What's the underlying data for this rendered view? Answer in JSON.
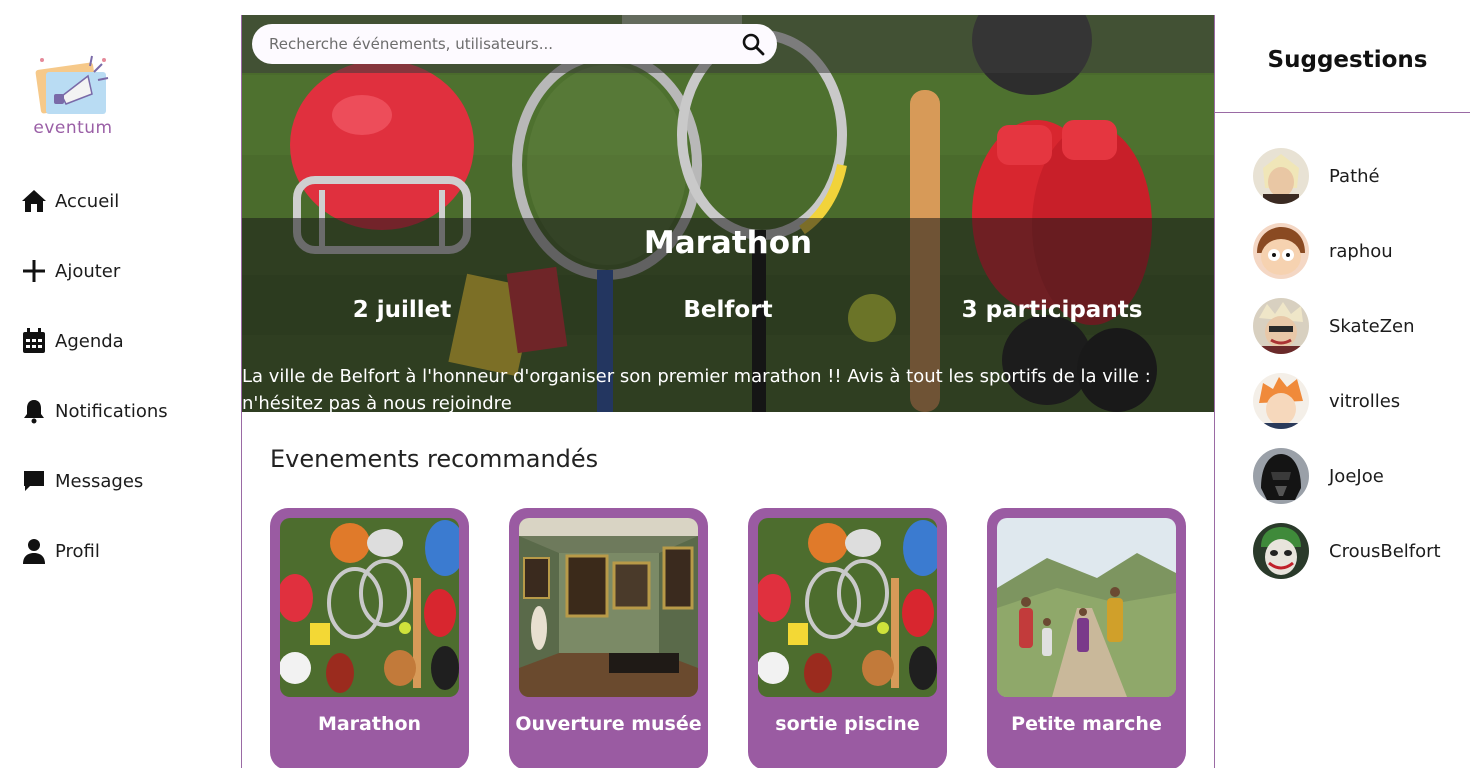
{
  "app": {
    "logo_text": "eventum"
  },
  "sidebar": {
    "items": [
      {
        "label": "Accueil",
        "icon": "home-icon"
      },
      {
        "label": "Ajouter",
        "icon": "plus-icon"
      },
      {
        "label": "Agenda",
        "icon": "calendar-icon"
      },
      {
        "label": "Notifications",
        "icon": "bell-icon"
      },
      {
        "label": "Messages",
        "icon": "message-icon"
      },
      {
        "label": "Profil",
        "icon": "user-icon"
      }
    ]
  },
  "search": {
    "placeholder": "Recherche événements, utilisateurs...",
    "value": ""
  },
  "hero": {
    "title": "Marathon",
    "date": "2 juillet",
    "city": "Belfort",
    "participants": "3 participants",
    "description": "La ville de Belfort à l'honneur d'organiser son premier marathon !! Avis à tout les sportifs de la ville : n'hésitez pas à nous rejoindre"
  },
  "recommended": {
    "title": "Evenements recommandés",
    "cards": [
      {
        "title": "Marathon",
        "image": "sports-equipment-image"
      },
      {
        "title": "Ouverture musée",
        "image": "museum-gallery-image"
      },
      {
        "title": "sortie piscine",
        "image": "sports-equipment-image"
      },
      {
        "title": "Petite marche",
        "image": "family-hike-image"
      }
    ]
  },
  "suggestions": {
    "title": "Suggestions",
    "users": [
      {
        "name": "Pathé"
      },
      {
        "name": "raphou"
      },
      {
        "name": "SkateZen"
      },
      {
        "name": "vitrolles"
      },
      {
        "name": "JoeJoe"
      },
      {
        "name": "CrousBelfort"
      }
    ]
  },
  "colors": {
    "accent": "#9a5ba2",
    "divider": "#9a6aa4"
  }
}
